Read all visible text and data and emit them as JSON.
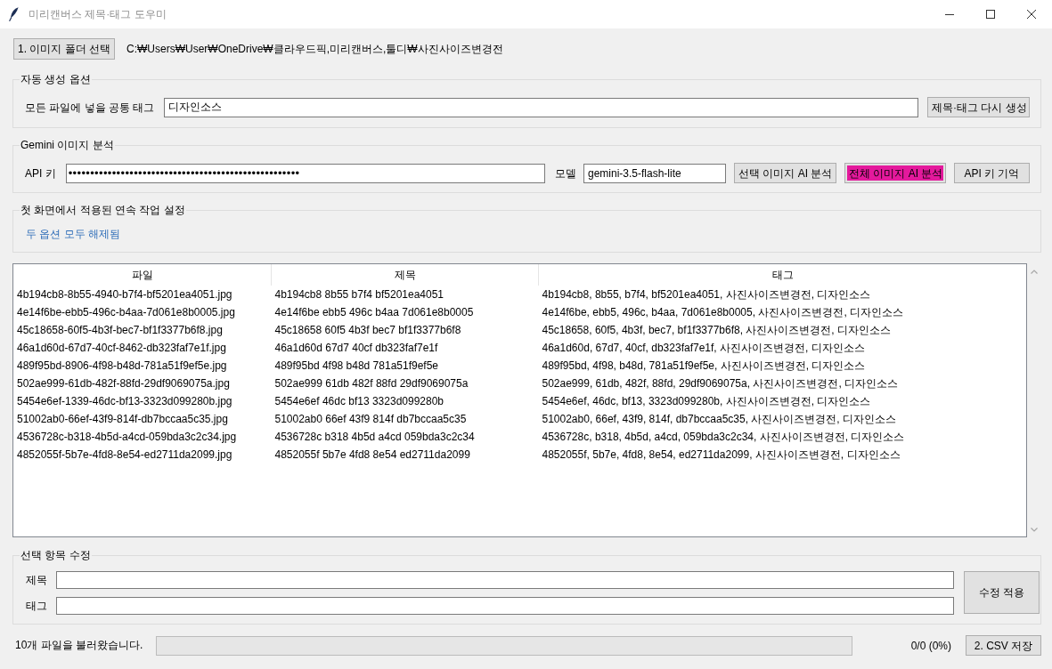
{
  "window": {
    "title": "미리캔버스 제목·태그 도우미"
  },
  "folder": {
    "button": "1. 이미지 폴더 선택",
    "path": "C:₩Users₩User₩OneDrive₩클라우드픽,미리캔버스,툴디₩사진사이즈변경전"
  },
  "auto_options": {
    "title": "자동 생성 옵션",
    "common_tag_label": "모든 파일에 넣을 공통 태그",
    "common_tag_value": "디자인소스",
    "regenerate_button": "제목·태그 다시 생성"
  },
  "gemini": {
    "title": "Gemini 이미지 분석",
    "api_key_label": "API 키",
    "api_key_value": "•••••••••••••••••••••••••••••••••••••••••••••••••••••",
    "model_label": "모델",
    "model_value": "gemini-3.5-flash-lite",
    "buttons": [
      {
        "label": "선택 이미지 AI 분석",
        "highlighted": false
      },
      {
        "label": "전체 이미지 AI 분석",
        "highlighted": true
      },
      {
        "label": "API 키 기억",
        "highlighted": false
      }
    ]
  },
  "workflow": {
    "title": "첫 화면에서 적용된 연속 작업 설정",
    "status": "두 옵션 모두 해제됨"
  },
  "table": {
    "columns": [
      "파일",
      "제목",
      "태그"
    ],
    "rows": [
      [
        "4b194cb8-8b55-4940-b7f4-bf5201ea4051.jpg",
        "4b194cb8 8b55 b7f4 bf5201ea4051",
        "4b194cb8, 8b55, b7f4, bf5201ea4051, 사진사이즈변경전, 디자인소스"
      ],
      [
        "4e14f6be-ebb5-496c-b4aa-7d061e8b0005.jpg",
        "4e14f6be ebb5 496c b4aa 7d061e8b0005",
        "4e14f6be, ebb5, 496c, b4aa, 7d061e8b0005, 사진사이즈변경전, 디자인소스"
      ],
      [
        "45c18658-60f5-4b3f-bec7-bf1f3377b6f8.jpg",
        "45c18658 60f5 4b3f bec7 bf1f3377b6f8",
        "45c18658, 60f5, 4b3f, bec7, bf1f3377b6f8, 사진사이즈변경전, 디자인소스"
      ],
      [
        "46a1d60d-67d7-40cf-8462-db323faf7e1f.jpg",
        "46a1d60d 67d7 40cf db323faf7e1f",
        "46a1d60d, 67d7, 40cf, db323faf7e1f, 사진사이즈변경전, 디자인소스"
      ],
      [
        "489f95bd-8906-4f98-b48d-781a51f9ef5e.jpg",
        "489f95bd 4f98 b48d 781a51f9ef5e",
        "489f95bd, 4f98, b48d, 781a51f9ef5e, 사진사이즈변경전, 디자인소스"
      ],
      [
        "502ae999-61db-482f-88fd-29df9069075a.jpg",
        "502ae999 61db 482f 88fd 29df9069075a",
        "502ae999, 61db, 482f, 88fd, 29df9069075a, 사진사이즈변경전, 디자인소스"
      ],
      [
        "5454e6ef-1339-46dc-bf13-3323d099280b.jpg",
        "5454e6ef 46dc bf13 3323d099280b",
        "5454e6ef, 46dc, bf13, 3323d099280b, 사진사이즈변경전, 디자인소스"
      ],
      [
        "51002ab0-66ef-43f9-814f-db7bccaa5c35.jpg",
        "51002ab0 66ef 43f9 814f db7bccaa5c35",
        "51002ab0, 66ef, 43f9, 814f, db7bccaa5c35, 사진사이즈변경전, 디자인소스"
      ],
      [
        "4536728c-b318-4b5d-a4cd-059bda3c2c34.jpg",
        "4536728c b318 4b5d a4cd 059bda3c2c34",
        "4536728c, b318, 4b5d, a4cd, 059bda3c2c34, 사진사이즈변경전, 디자인소스"
      ],
      [
        "4852055f-5b7e-4fd8-8e54-ed2711da2099.jpg",
        "4852055f 5b7e 4fd8 8e54 ed2711da2099",
        "4852055f, 5b7e, 4fd8, 8e54, ed2711da2099, 사진사이즈변경전, 디자인소스"
      ]
    ]
  },
  "edit": {
    "title": "선택 항목 수정",
    "fields": [
      {
        "label": "제목"
      },
      {
        "label": "태그"
      }
    ],
    "apply_button": "수정 적용"
  },
  "status_bar": {
    "message": "10개 파일을 불러왔습니다.",
    "progress": {
      "level": 0
    },
    "count": "0/0 (0%)",
    "save_button": "2. CSV 저장"
  }
}
